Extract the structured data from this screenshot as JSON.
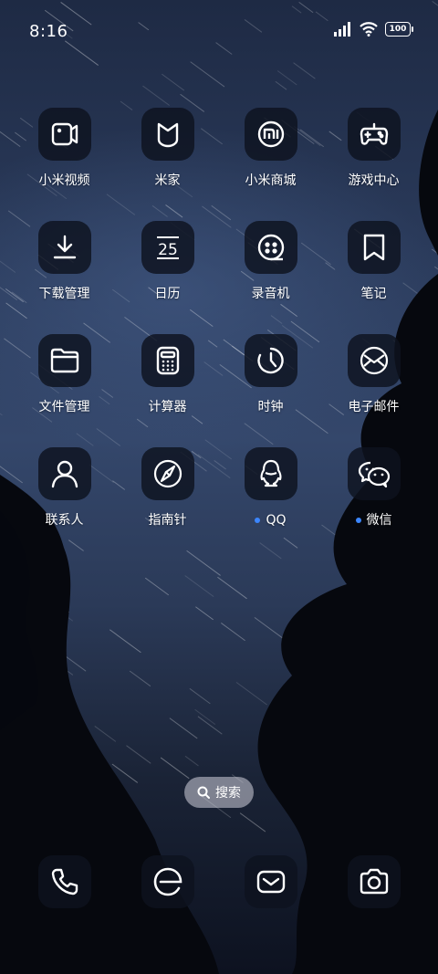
{
  "status_bar": {
    "time": "8:16",
    "battery": "100"
  },
  "apps": [
    {
      "label": "小米视频",
      "icon": "video-icon"
    },
    {
      "label": "米家",
      "icon": "mijia-icon"
    },
    {
      "label": "小米商城",
      "icon": "mi-store-icon"
    },
    {
      "label": "游戏中心",
      "icon": "gamepad-icon"
    },
    {
      "label": "下载管理",
      "icon": "download-icon"
    },
    {
      "label": "日历",
      "icon": "calendar-icon",
      "calendar_day": "25"
    },
    {
      "label": "录音机",
      "icon": "recorder-icon"
    },
    {
      "label": "笔记",
      "icon": "bookmark-icon"
    },
    {
      "label": "文件管理",
      "icon": "folder-icon"
    },
    {
      "label": "计算器",
      "icon": "calculator-icon"
    },
    {
      "label": "时钟",
      "icon": "clock-icon"
    },
    {
      "label": "电子邮件",
      "icon": "envelope-icon"
    },
    {
      "label": "联系人",
      "icon": "person-icon"
    },
    {
      "label": "指南针",
      "icon": "compass-icon"
    },
    {
      "label": "QQ",
      "icon": "qq-penguin-icon",
      "new_dot": true
    },
    {
      "label": "微信",
      "icon": "wechat-icon",
      "new_dot": true
    }
  ],
  "search": {
    "label": "搜索"
  },
  "dock": [
    {
      "icon": "phone-icon"
    },
    {
      "icon": "browser-icon"
    },
    {
      "icon": "messages-icon"
    },
    {
      "icon": "camera-icon"
    }
  ],
  "colors": {
    "notification_dot": "#3c86ff",
    "icon_tile": "#0e121e"
  }
}
